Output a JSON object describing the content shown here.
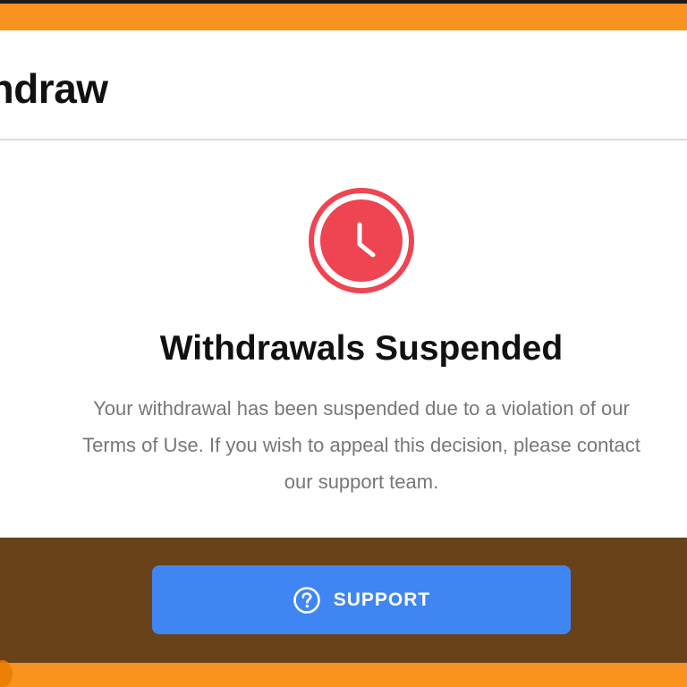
{
  "dialog": {
    "title": "Withdraw",
    "icon": "clock-icon",
    "accent_color": "#ef4452",
    "headline": "Withdrawals Suspended",
    "message_lines": [
      "Your withdrawal has been suspended due to a violation of our",
      "Terms of Use. If you wish to appeal this decision, please contact",
      "our support team."
    ]
  },
  "footer": {
    "background": "#69421a",
    "support_button": {
      "label": "SUPPORT",
      "icon": "help-circle-icon",
      "color": "#3f86f2"
    }
  },
  "page": {
    "background": "#f7931e"
  }
}
